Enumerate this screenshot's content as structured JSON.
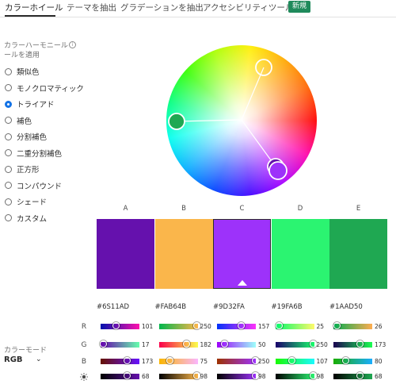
{
  "tabs": [
    {
      "label": "カラーホイール",
      "active": true
    },
    {
      "label": "テーマを抽出",
      "active": false
    },
    {
      "label": "グラデーションを抽出",
      "active": false
    },
    {
      "label": "アクセシビリティツール",
      "active": false
    }
  ],
  "new_badge": "新規",
  "harmony": {
    "label": "カラーハーモニールールを適用",
    "info_icon": "info-icon",
    "options": [
      "類似色",
      "モノクロマティック",
      "トライアド",
      "補色",
      "分割補色",
      "二重分割補色",
      "正方形",
      "コンパウンド",
      "シェード",
      "カスタム"
    ],
    "selected": "トライアド"
  },
  "color_mode": {
    "label": "カラーモード",
    "value": "RGB",
    "icon": "chevron-down-icon"
  },
  "swatches": [
    {
      "letter": "A",
      "hex": "#6S11AD",
      "color": "#6511ad"
    },
    {
      "letter": "B",
      "hex": "#FAB64B",
      "color": "#fab64b"
    },
    {
      "letter": "C",
      "hex": "#9D32FA",
      "color": "#9d32fa",
      "selected": true
    },
    {
      "letter": "D",
      "hex": "#19FA6B",
      "color": "#2bf471"
    },
    {
      "letter": "E",
      "hex": "#1AAD50",
      "color": "#1fa852"
    }
  ],
  "slider_rows": {
    "r": "R",
    "g": "G",
    "b": "B",
    "brightness_icon": "sun-icon"
  },
  "sliders": [
    {
      "r": 101,
      "g": 17,
      "b": 173,
      "br": 68
    },
    {
      "r": 250,
      "g": 182,
      "b": 75,
      "br": 98
    },
    {
      "r": 157,
      "g": 50,
      "b": 250,
      "br": 98
    },
    {
      "r": 25,
      "g": 250,
      "b": 107,
      "br": 98
    },
    {
      "r": 26,
      "g": 173,
      "b": 80,
      "br": 68
    }
  ]
}
